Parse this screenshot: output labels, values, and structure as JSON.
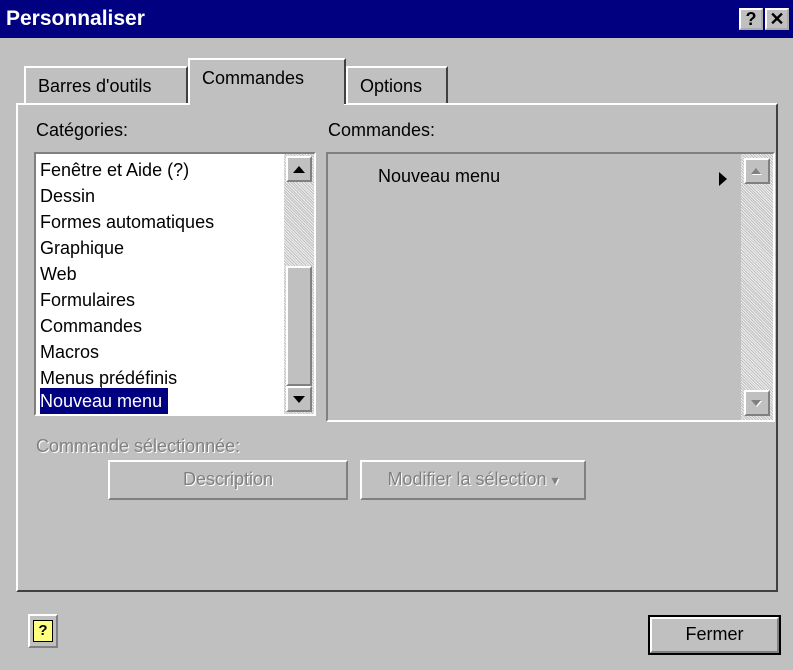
{
  "window": {
    "title": "Personnaliser",
    "help_glyph": "?",
    "close_glyph": "✕"
  },
  "tabs": [
    {
      "label": "Barres d'outils",
      "active": false
    },
    {
      "label": "Commandes",
      "active": true
    },
    {
      "label": "Options",
      "active": false
    }
  ],
  "categories": {
    "label": "Catégories:",
    "items": [
      "Fenêtre et Aide (?)",
      "Dessin",
      "Formes automatiques",
      "Graphique",
      "Web",
      "Formulaires",
      "Commandes",
      "Macros",
      "Menus prédéfinis",
      "Nouveau menu"
    ],
    "selected": "Nouveau menu"
  },
  "commands": {
    "label": "Commandes:",
    "items": [
      {
        "label": "Nouveau menu",
        "has_submenu": true
      }
    ]
  },
  "selected_command": {
    "label": "Commande sélectionnée:",
    "description_button": "Description",
    "modify_button": "Modifier la sélection",
    "modify_arrow": "▾"
  },
  "footer": {
    "help_glyph": "?",
    "close_button": "Fermer"
  },
  "colors": {
    "titlebar": "#000080",
    "face": "#c0c0c0",
    "selection": "#000080"
  }
}
